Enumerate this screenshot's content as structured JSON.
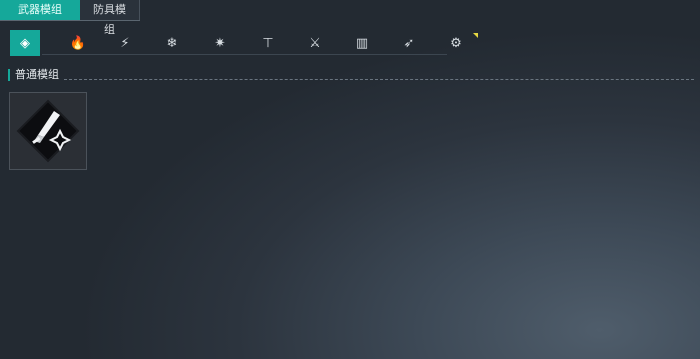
{
  "tabs": [
    {
      "label": "武器模组",
      "active": true
    },
    {
      "label": "防具模组",
      "active": false
    }
  ],
  "filters": [
    {
      "icon": "diamond-icon",
      "glyph": "◈",
      "active": true
    },
    {
      "icon": "fire-icon",
      "glyph": "🔥",
      "active": false
    },
    {
      "icon": "lightning-icon",
      "glyph": "⚡",
      "active": false
    },
    {
      "icon": "snowflake-icon",
      "glyph": "❄",
      "active": false
    },
    {
      "icon": "burst-icon",
      "glyph": "✷",
      "active": false
    },
    {
      "icon": "anvil-icon",
      "glyph": "⊤",
      "active": false
    },
    {
      "icon": "crossed-swords-icon",
      "glyph": "⚔",
      "active": false
    },
    {
      "icon": "ammo-icon",
      "glyph": "▥",
      "active": false
    },
    {
      "icon": "crosshair-arrow-icon",
      "glyph": "➶",
      "active": false
    },
    {
      "icon": "gear-blade-icon",
      "glyph": "⚙",
      "active": false
    }
  ],
  "section": {
    "title": "普通模组"
  },
  "modules": [
    {
      "icon": "knife-shuriken-icon"
    }
  ],
  "colors": {
    "accent": "#15a89a",
    "notch": "#e5d842"
  }
}
